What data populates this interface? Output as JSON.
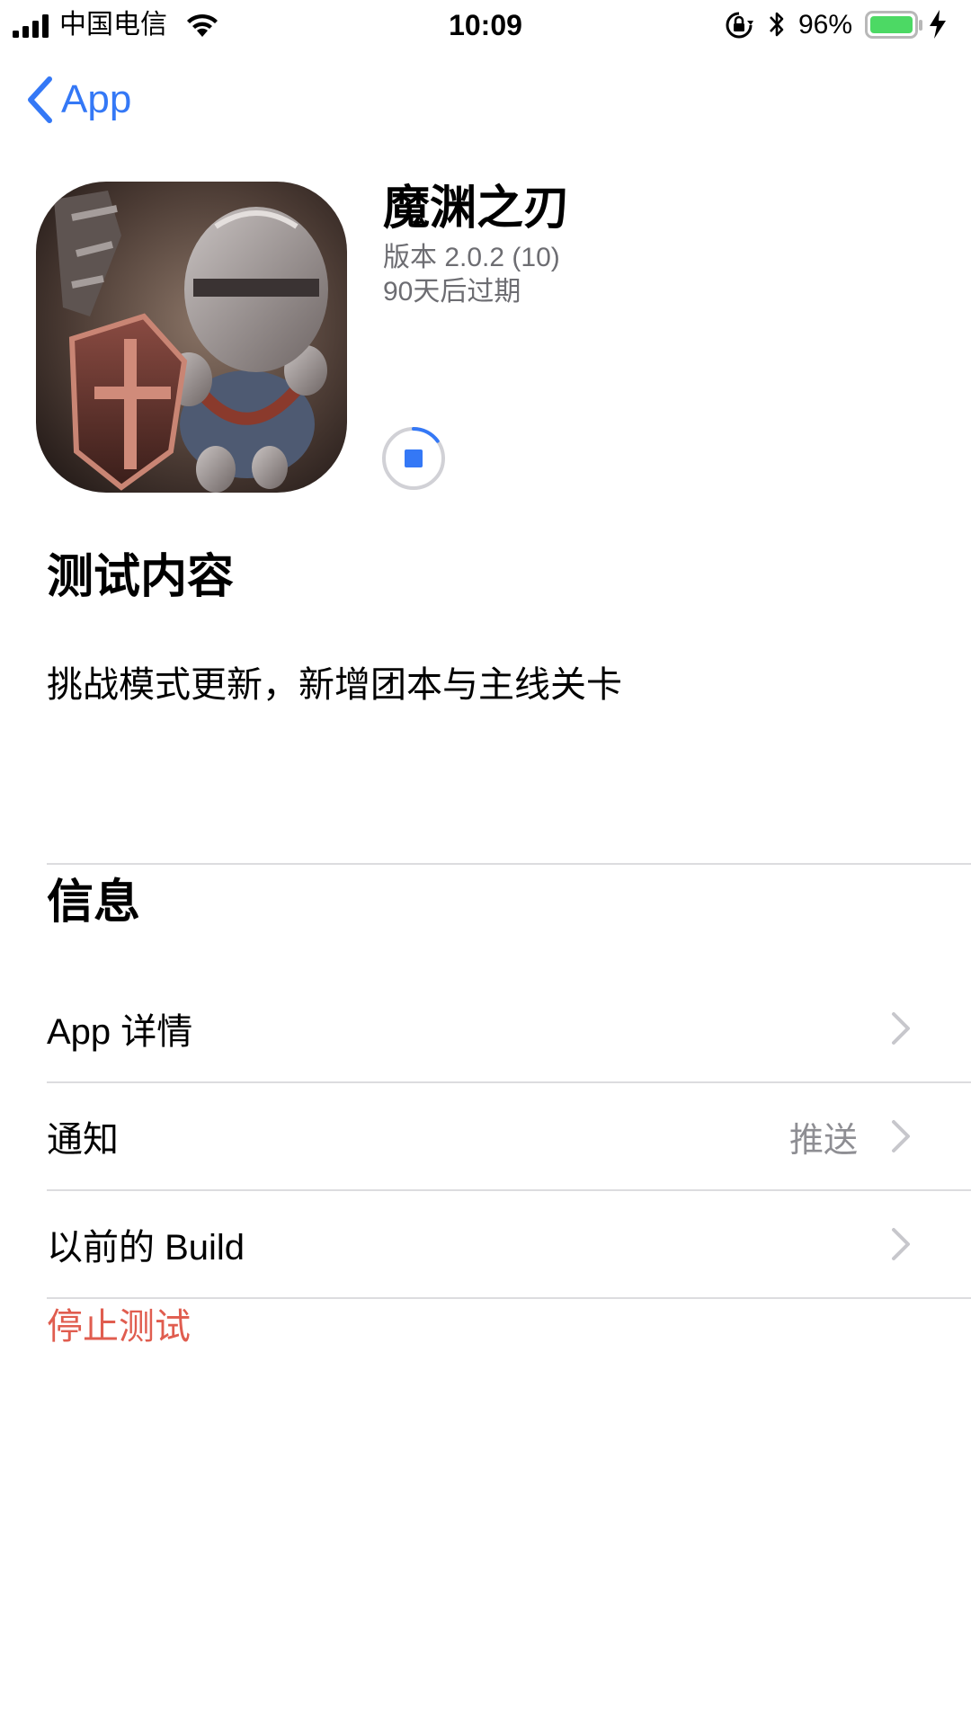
{
  "status_bar": {
    "carrier": "中国电信",
    "time": "10:09",
    "battery_percent": "96%"
  },
  "nav": {
    "back_label": "App"
  },
  "app": {
    "name": "魔渊之刃",
    "version": "版本 2.0.2 (10)",
    "expiry": "90天后过期",
    "install_progress": 0.15
  },
  "test_section": {
    "title": "测试内容",
    "body": "挑战模式更新，新增团本与主线关卡"
  },
  "info_section": {
    "title": "信息",
    "rows": [
      {
        "label": "App 详情",
        "value": ""
      },
      {
        "label": "通知",
        "value": "推送"
      },
      {
        "label": "以前的 Build",
        "value": ""
      }
    ]
  },
  "stop_testing": "停止测试",
  "colors": {
    "accent": "#3478f6",
    "destructive": "#e05d4f",
    "battery": "#4cd964",
    "secondary_text": "#8e8e93"
  }
}
